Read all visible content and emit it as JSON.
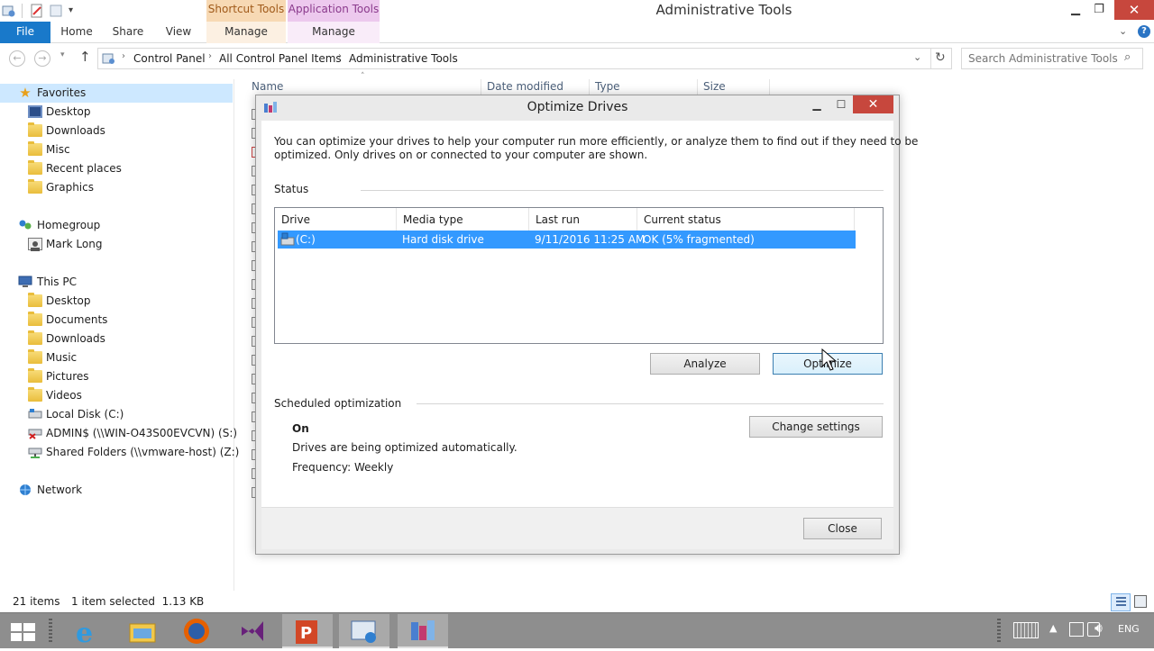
{
  "window": {
    "title": "Administrative Tools"
  },
  "ribbon": {
    "context_tabs": [
      "Shortcut Tools",
      "Application Tools"
    ],
    "tabs": [
      "File",
      "Home",
      "Share",
      "View",
      "Manage",
      "Manage"
    ]
  },
  "address": {
    "breadcrumbs": [
      "Control Panel",
      "All Control Panel Items",
      "Administrative Tools"
    ],
    "search_placeholder": "Search Administrative Tools"
  },
  "nav": {
    "favorites": "Favorites",
    "favorites_items": [
      "Desktop",
      "Downloads",
      "Misc",
      "Recent places",
      "Graphics"
    ],
    "homegroup": "Homegroup",
    "homegroup_items": [
      "Mark Long"
    ],
    "thispc": "This PC",
    "thispc_items": [
      "Desktop",
      "Documents",
      "Downloads",
      "Music",
      "Pictures",
      "Videos",
      "Local Disk (C:)",
      "ADMIN$ (\\\\WIN-O43S00EVCVN) (S:)",
      "Shared Folders (\\\\vmware-host) (Z:)"
    ],
    "network": "Network"
  },
  "filelist": {
    "columns": [
      "Name",
      "Date modified",
      "Type",
      "Size"
    ]
  },
  "status": {
    "item_count": "21 items",
    "selection": "1 item selected  1.13 KB"
  },
  "taskbar": {
    "language": "ENG"
  },
  "dialog": {
    "title": "Optimize Drives",
    "description_line1": "You can optimize your drives to help your computer run more efficiently, or analyze them to find out if they need to be",
    "description_line2": "optimized. Only drives on or connected to your computer are shown.",
    "status_header": "Status",
    "columns": [
      "Drive",
      "Media type",
      "Last run",
      "Current status"
    ],
    "drives": [
      {
        "drive": "(C:)",
        "media_type": "Hard disk drive",
        "last_run": "9/11/2016 11:25 AM",
        "current_status": "OK (5% fragmented)"
      }
    ],
    "analyze_label": "Analyze",
    "optimize_label": "Optimize",
    "scheduled_header": "Scheduled optimization",
    "schedule_state": "On",
    "schedule_desc": "Drives are being optimized automatically.",
    "frequency": "Frequency: Weekly",
    "change_settings_label": "Change settings",
    "close_label": "Close"
  }
}
